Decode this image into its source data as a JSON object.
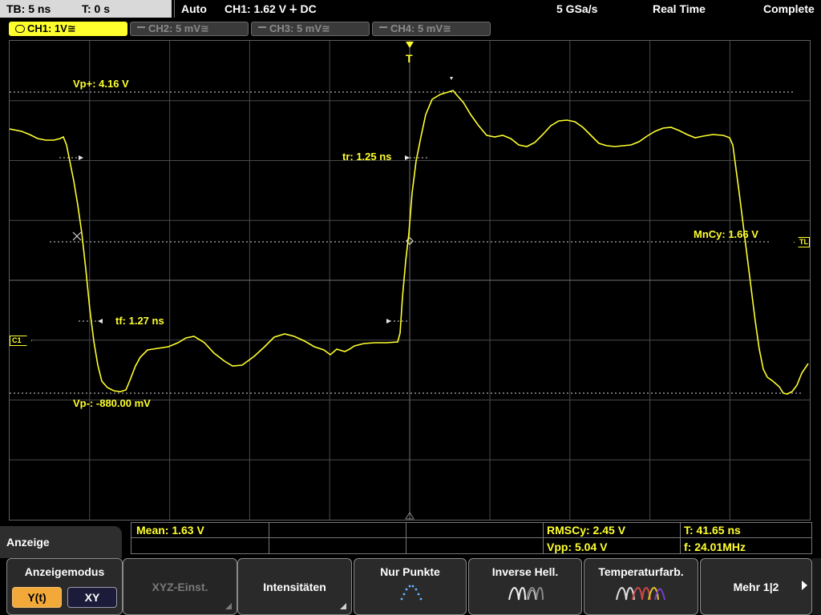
{
  "status_bar": {
    "timebase": "TB: 5 ns",
    "trigger_time": "T: 0 s",
    "trigger_mode": "Auto",
    "trigger_info": "CH1: 1.62 V ∔ DC",
    "sample_rate": "5 GSa/s",
    "acq_mode": "Real Time",
    "acq_state": "Complete"
  },
  "channel_tabs": [
    {
      "label": "CH1: 1V≅",
      "active": true
    },
    {
      "label": "CH2: 5 mV≅",
      "active": false
    },
    {
      "label": "CH3: 5 mV≅",
      "active": false
    },
    {
      "label": "CH4: 5 mV≅",
      "active": false
    }
  ],
  "scope": {
    "trigger_marker": "T",
    "trigger_level_marker": "TL",
    "channel_marker": "C1",
    "cursor_labels": {
      "vp_plus": "Vp+: 4.16 V",
      "vp_minus": "Vp-: -880.00 mV",
      "rise_time": "tr: 1.25 ns",
      "fall_time": "tf: 1.27 ns",
      "mean_cycle": "MnCy: 1.66 V"
    },
    "colors": {
      "trace": "#ffff2e",
      "grid": "#606060",
      "background": "#000000"
    }
  },
  "measurements": {
    "mean": "Mean: 1.63 V",
    "rms_cycle": "RMSCy: 2.45 V",
    "period": "T: 41.65 ns",
    "vpp": "Vpp: 5.04 V",
    "frequency": "f: 24.01MHz"
  },
  "menu": {
    "title": "Anzeige",
    "display_mode": {
      "caption": "Anzeigemodus",
      "options": [
        "Y(t)",
        "XY"
      ],
      "selected": "Y(t)"
    },
    "xyz_settings": "XYZ-Einst.",
    "intensities": "Intensitäten",
    "dots_only": "Nur Punkte",
    "inverse_brightness": "Inverse Hell.",
    "temperature_colors": "Temperaturfarb.",
    "more": "Mehr 1|2"
  }
}
